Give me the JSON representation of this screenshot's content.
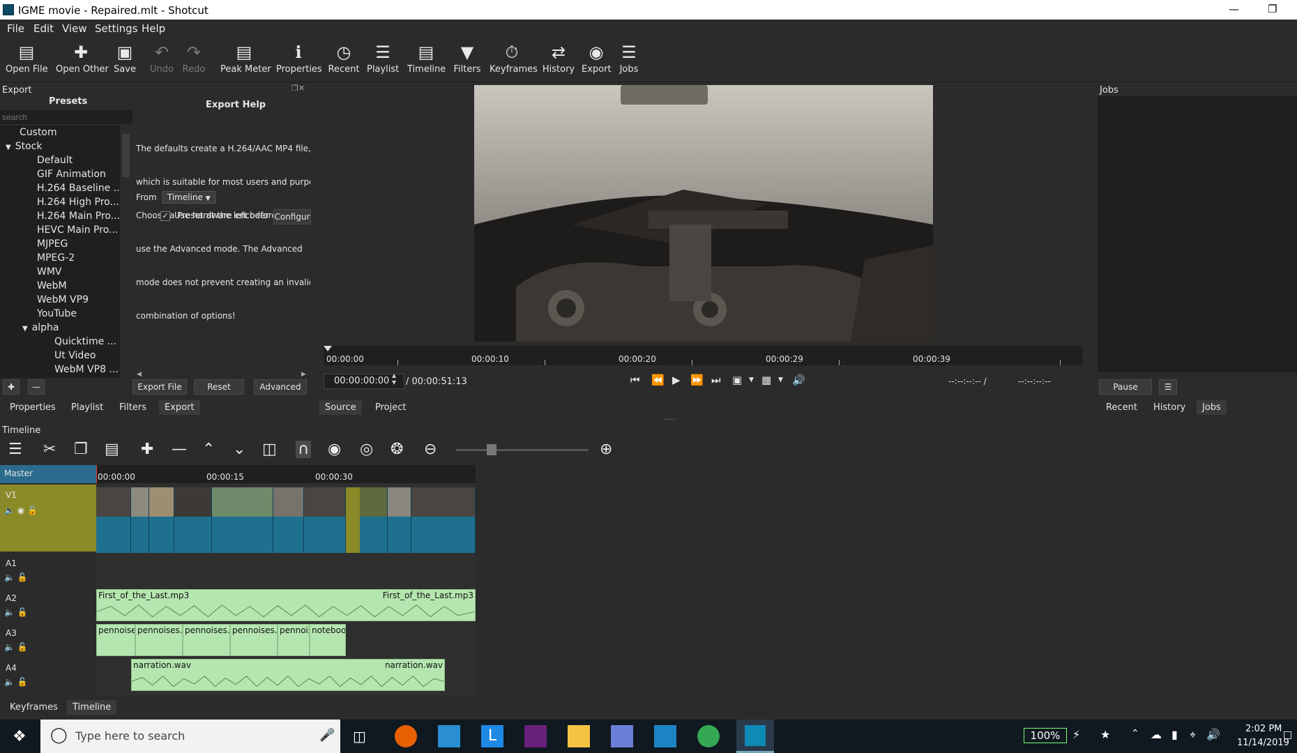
{
  "window": {
    "title": "IGME movie - Repaired.mlt - Shotcut"
  },
  "menu": [
    "File",
    "Edit",
    "View",
    "Settings",
    "Help"
  ],
  "toolbar": [
    {
      "label": "Open File",
      "icon": "folder-open-icon"
    },
    {
      "label": "Open Other",
      "icon": "open-other-icon"
    },
    {
      "label": "Save",
      "icon": "save-icon"
    },
    {
      "label": "Undo",
      "icon": "undo-icon"
    },
    {
      "label": "Redo",
      "icon": "redo-icon"
    },
    {
      "label": "Peak Meter",
      "icon": "peak-meter-icon"
    },
    {
      "label": "Properties",
      "icon": "info-icon"
    },
    {
      "label": "Recent",
      "icon": "clock-icon"
    },
    {
      "label": "Playlist",
      "icon": "list-icon"
    },
    {
      "label": "Timeline",
      "icon": "timeline-icon"
    },
    {
      "label": "Filters",
      "icon": "filter-icon"
    },
    {
      "label": "Keyframes",
      "icon": "stopwatch-icon"
    },
    {
      "label": "History",
      "icon": "history-icon"
    },
    {
      "label": "Export",
      "icon": "disc-icon"
    },
    {
      "label": "Jobs",
      "icon": "database-icon"
    }
  ],
  "export": {
    "panel_title": "Export",
    "presets_title": "Presets",
    "search_placeholder": "search",
    "presets": [
      "Custom",
      "Stock",
      "Default",
      "GIF Animation",
      "H.264 Baseline ...",
      "H.264 High Pro...",
      "H.264 Main Pro...",
      "HEVC Main Pro...",
      "MJPEG",
      "MPEG-2",
      "WMV",
      "WebM",
      "WebM VP9",
      "YouTube",
      "alpha",
      "Quicktime ...",
      "Ut Video",
      "WebM VP8 ..."
    ],
    "help_title": "Export Help",
    "help_lines": [
      "The defaults create a H.264/AAC MP4 file,",
      "which is suitable for most users and purpos",
      "Choose a Preset at the left before decidin",
      "use the Advanced mode. The Advanced",
      "mode does not prevent creating an invalid",
      "combination of options!"
    ],
    "from_label": "From",
    "from_value": "Timeline",
    "hw_encoder_label": "Use hardware encoder",
    "configure_label": "Configur",
    "export_file_label": "Export File",
    "reset_label": "Reset",
    "advanced_label": "Advanced"
  },
  "left_tabs": [
    "Properties",
    "Playlist",
    "Filters",
    "Export"
  ],
  "player": {
    "ruler": [
      "00:00:00",
      "00:00:10",
      "00:00:20",
      "00:00:29",
      "00:00:39"
    ],
    "position": "00:00:00:00",
    "duration": "/ 00:00:51:13",
    "in_point": "--:--:--:-- /",
    "out_point": "--:--:--:--",
    "tabs": [
      "Source",
      "Project"
    ],
    "handle": "....."
  },
  "jobs": {
    "title": "Jobs",
    "pause_label": "Pause",
    "menu_icon": "☰",
    "tabs": [
      "Recent",
      "History",
      "Jobs"
    ]
  },
  "timeline": {
    "title": "Timeline",
    "ruler": [
      "00:00:00",
      "00:00:15",
      "00:00:30"
    ],
    "master_label": "Master",
    "tracks": [
      "V1",
      "A1",
      "A2",
      "A3",
      "A4"
    ],
    "audio_clips": {
      "a2_left": "First_of_the_Last.mp3",
      "a2_right": "First_of_the_Last.mp3",
      "a3": [
        "pennoises.v",
        "pennoises.v",
        "pennoises.v",
        "pennoises.v",
        "pennois",
        "noteboo"
      ],
      "a4_left": "narration.wav",
      "a4_right": "narration.wav"
    }
  },
  "bottom_tabs": [
    "Keyframes",
    "Timeline"
  ],
  "taskbar": {
    "search_placeholder": "Type here to search",
    "battery": "100%",
    "time": "2:02 PM",
    "date": "11/14/2019"
  },
  "colors": {
    "accent": "#1f6f8f",
    "track_header": "#8a8a28",
    "audio_clip": "#b6e6b0",
    "master_header": "#2b6b8e"
  }
}
